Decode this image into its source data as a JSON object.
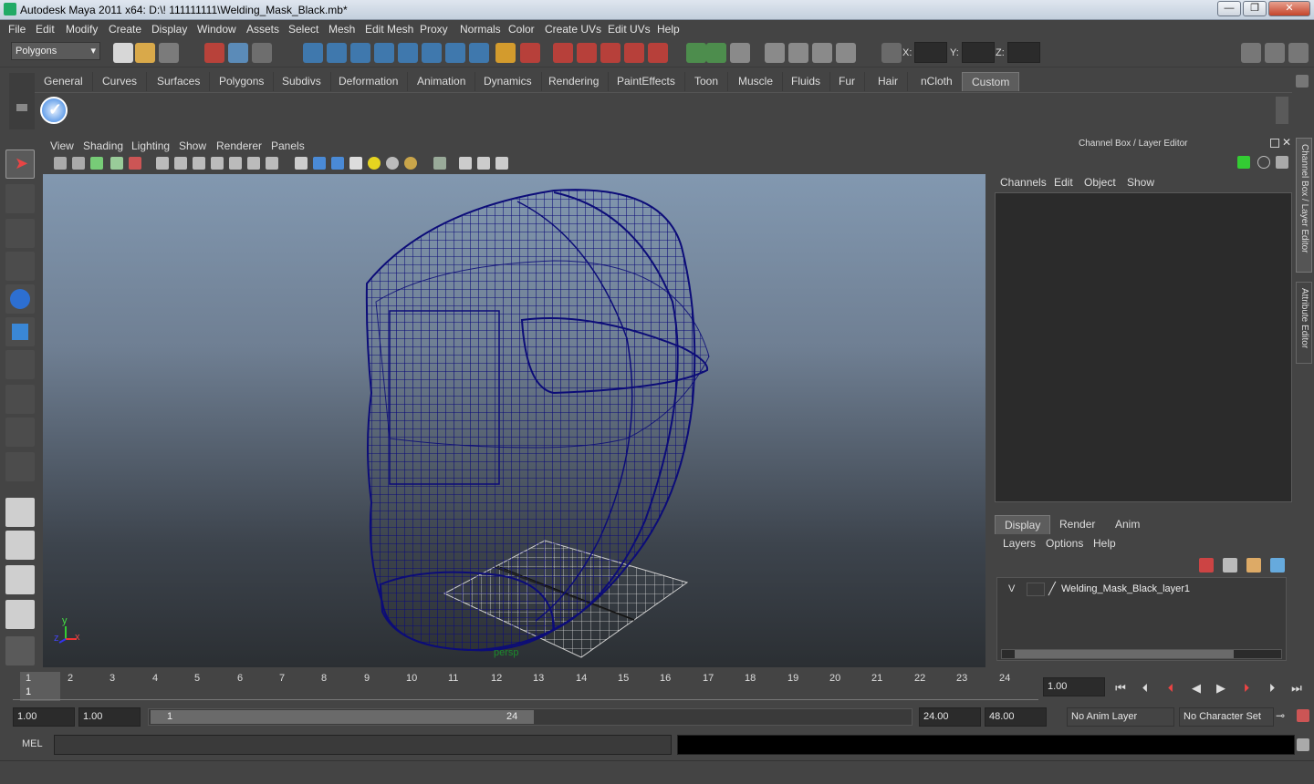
{
  "window": {
    "title": "Autodesk Maya 2011 x64: D:\\! 111111111\\Welding_Mask_Black.mb*",
    "minimize": "—",
    "maximize": "❐",
    "close": "✕"
  },
  "menubar": [
    "File",
    "Edit",
    "Modify",
    "Create",
    "Display",
    "Window",
    "Assets",
    "Select",
    "Mesh",
    "Edit Mesh",
    "Proxy",
    "Normals",
    "Color",
    "Create UVs",
    "Edit UVs",
    "Help"
  ],
  "status": {
    "mode": "Polygons",
    "x_label": "X:",
    "y_label": "Y:",
    "z_label": "Z:"
  },
  "shelf": {
    "tabs": [
      "General",
      "Curves",
      "Surfaces",
      "Polygons",
      "Subdivs",
      "Deformation",
      "Animation",
      "Dynamics",
      "Rendering",
      "PaintEffects",
      "Toon",
      "Muscle",
      "Fluids",
      "Fur",
      "Hair",
      "nCloth",
      "Custom"
    ],
    "active": "Custom"
  },
  "viewport": {
    "menus": [
      "View",
      "Shading",
      "Lighting",
      "Show",
      "Renderer",
      "Panels"
    ],
    "camera": "persp",
    "axis_x": "x",
    "axis_y": "y",
    "axis_z": "z"
  },
  "channelbox": {
    "title": "Channel Box / Layer Editor",
    "menus": [
      "Channels",
      "Edit",
      "Object",
      "Show"
    ]
  },
  "sidetabs": {
    "channel": "Channel Box / Layer Editor",
    "attr": "Attribute Editor"
  },
  "layereditor": {
    "tabs": [
      "Display",
      "Render",
      "Anim"
    ],
    "active": "Display",
    "menus": [
      "Layers",
      "Options",
      "Help"
    ],
    "layer": {
      "visible": "V",
      "name": "Welding_Mask_Black_layer1"
    }
  },
  "timeslider": {
    "ticks": [
      "1",
      "2",
      "3",
      "4",
      "5",
      "6",
      "7",
      "8",
      "9",
      "10",
      "11",
      "12",
      "13",
      "14",
      "15",
      "16",
      "17",
      "18",
      "19",
      "20",
      "21",
      "22",
      "23",
      "24"
    ],
    "current_marker": "1",
    "current_time": "1.00"
  },
  "range": {
    "start": "1.00",
    "start2": "1.00",
    "range_start": "1",
    "range_end": "24",
    "end": "24.00",
    "end2": "48.00",
    "anim_layer": "No Anim Layer",
    "char_set": "No Character Set"
  },
  "command": {
    "label": "MEL"
  }
}
